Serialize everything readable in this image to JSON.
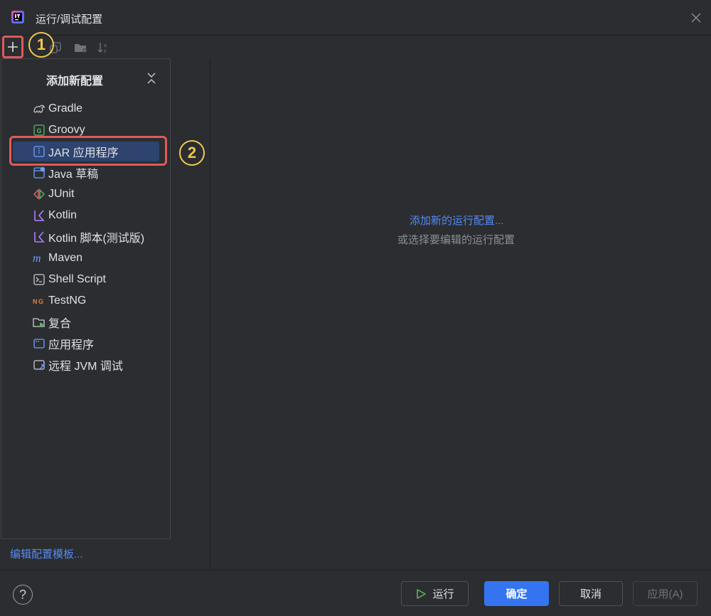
{
  "window": {
    "title": "运行/调试配置"
  },
  "annotations": {
    "step1": "1",
    "step2": "2"
  },
  "popup": {
    "title": "添加新配置",
    "items": [
      {
        "label": "Gradle",
        "icon": "gradle-icon"
      },
      {
        "label": "Groovy",
        "icon": "groovy-icon"
      },
      {
        "label": "JAR 应用程序",
        "icon": "jar-app-icon",
        "selected": true
      },
      {
        "label": "Java 草稿",
        "icon": "java-scratch-icon"
      },
      {
        "label": "JUnit",
        "icon": "junit-icon"
      },
      {
        "label": "Kotlin",
        "icon": "kotlin-icon"
      },
      {
        "label": "Kotlin 脚本(测试版)",
        "icon": "kotlin-script-icon"
      },
      {
        "label": "Maven",
        "icon": "maven-icon"
      },
      {
        "label": "Shell Script",
        "icon": "shell-script-icon"
      },
      {
        "label": "TestNG",
        "icon": "testng-icon"
      },
      {
        "label": "复合",
        "icon": "compound-icon"
      },
      {
        "label": "应用程序",
        "icon": "application-icon"
      },
      {
        "label": "远程 JVM 调试",
        "icon": "remote-jvm-debug-icon"
      }
    ]
  },
  "left": {
    "edit_templates": "编辑配置模板..."
  },
  "main": {
    "add_link": "添加新的运行配置...",
    "hint": "或选择要编辑的运行配置"
  },
  "footer": {
    "help": "?",
    "run": "运行",
    "ok": "确定",
    "cancel": "取消",
    "apply": "应用(A)"
  },
  "colors": {
    "background": "#2b2d30",
    "accent": "#3574f0",
    "link": "#548af7",
    "selection": "#2e436e",
    "highlight": "#e05a5a",
    "annotation": "#f2c94c"
  }
}
